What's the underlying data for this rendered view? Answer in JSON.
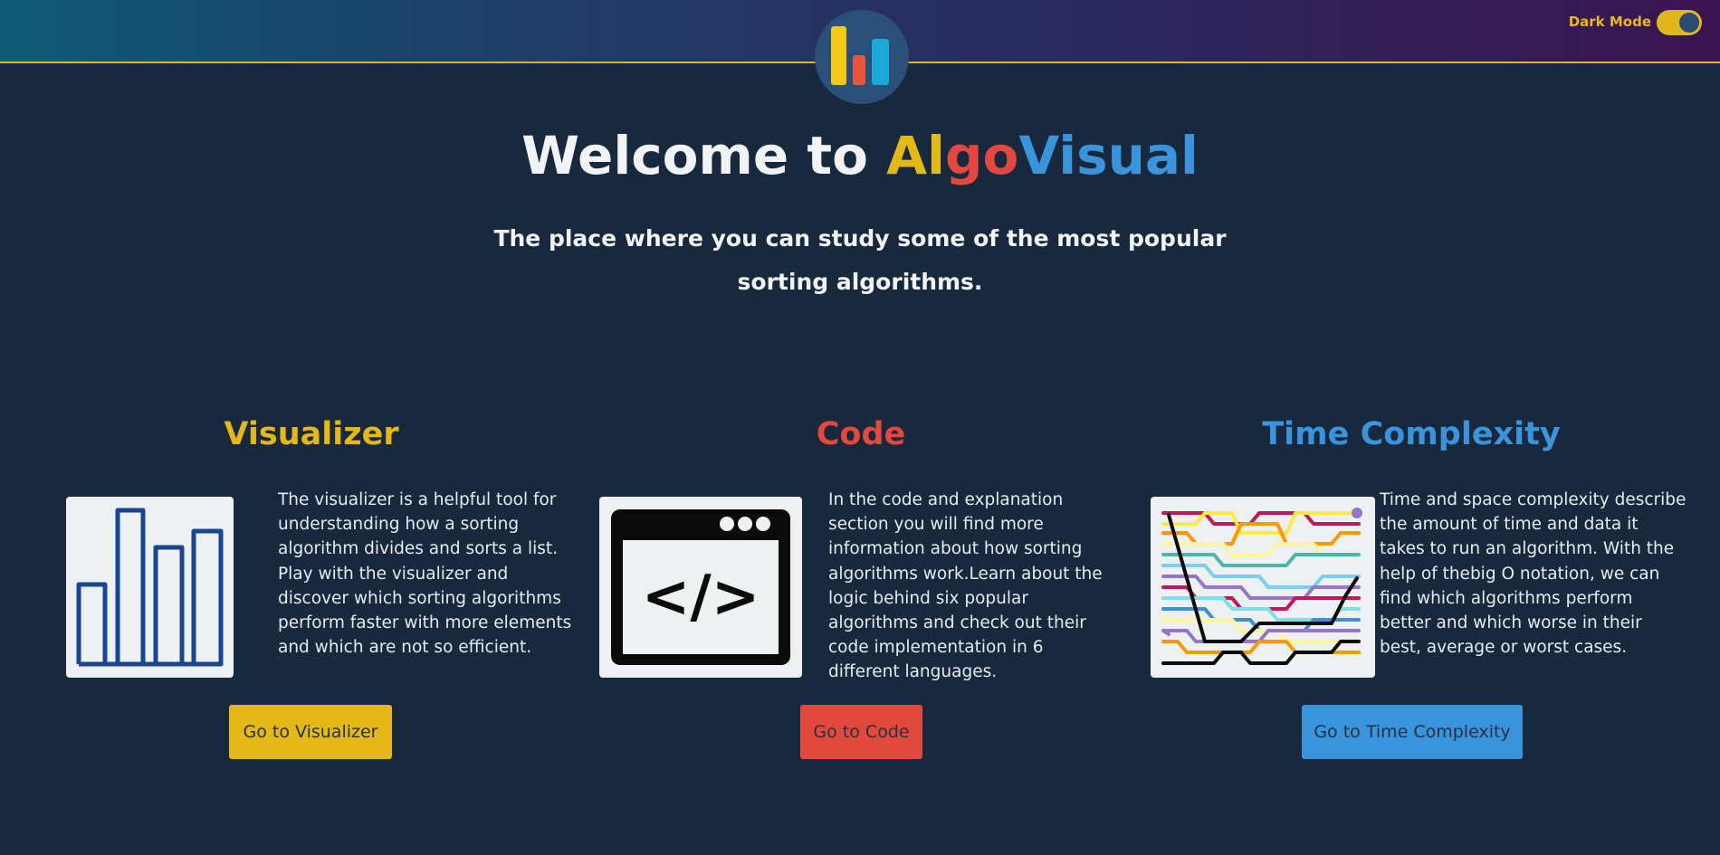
{
  "header": {
    "dark_mode_label": "Dark Mode",
    "dark_mode_on": true
  },
  "hero": {
    "title_prefix": "Welcome to",
    "brand_part1": "Al",
    "brand_part2": "go",
    "brand_part3": "Visual",
    "subtitle": "The place where you can study some of the most popular sorting algorithms."
  },
  "cards": [
    {
      "title": "Visualizer",
      "text": "The visualizer is a helpful tool for understanding how a sorting algorithm divides and sorts a list. Play with the visualizer and discover which sorting algorithms perform faster with more elements and which are not so efficient.",
      "button": "Go to Visualizer",
      "icon": "bar-chart-icon"
    },
    {
      "title": "Code",
      "text": "In the code and explanation section you will find more information about how sorting algorithms work.Learn about the logic behind six popular algorithms and check out their code implementation in 6 different languages.",
      "button": "Go to Code",
      "icon": "code-window-icon"
    },
    {
      "title": "Time Complexity",
      "text": "Time and space complexity describe the amount of time and data it takes to run an algorithm. With the help of thebig O notation, we can find which algorithms perform better and which worse in their best, average or worst cases.",
      "button": "Go to Time Complexity",
      "icon": "sorting-network-icon"
    }
  ],
  "colors": {
    "background": "#18283d",
    "yellow": "#e3b817",
    "red": "#e2483d",
    "blue": "#3a94dc",
    "accent_line": "#e0b71a"
  }
}
